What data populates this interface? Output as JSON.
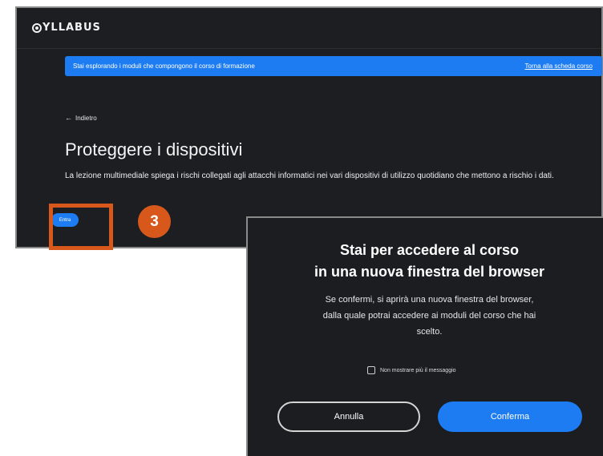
{
  "app": {
    "logo_text": "YLLABUS"
  },
  "info_bar": {
    "text": "Stai esplorando i moduli che compongono il corso di formazione",
    "link": "Torna alla scheda corso"
  },
  "page": {
    "back_label": "Indietro",
    "title": "Proteggere i dispositivi",
    "description": "La lezione multimediale spiega i rischi collegati agli attacchi informatici nei vari dispositivi di utilizzo quotidiano che mettono a rischio i dati.",
    "enter_label": "Entra"
  },
  "annotation": {
    "step_number": "3"
  },
  "modal": {
    "title_line1": "Stai per accedere al corso",
    "title_line2": "in una nuova finestra del browser",
    "body_line1": "Se confermi, si aprirà una nuova finestra del browser,",
    "body_line2": "dalla quale potrai accedere ai moduli del corso che hai",
    "body_line3": "scelto.",
    "checkbox_label": "Non mostrare più il messaggio",
    "checkbox_checked": false,
    "cancel_label": "Annulla",
    "confirm_label": "Conferma"
  },
  "colors": {
    "accent": "#1e7cf2",
    "background": "#1d1e22",
    "annotation": "#d8581c"
  },
  "icons": {
    "back": "arrow-left-icon",
    "logo": "syllabus-logo-icon"
  }
}
